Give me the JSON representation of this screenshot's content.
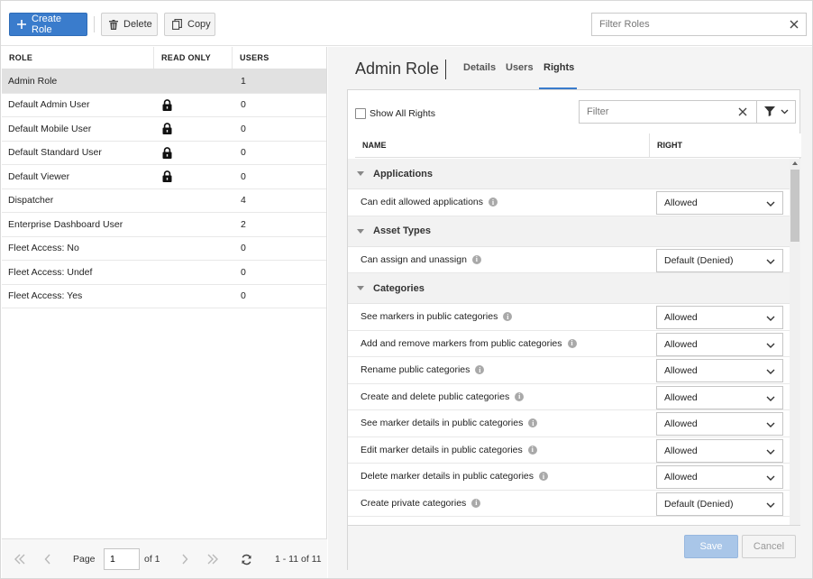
{
  "toolbar": {
    "create_label": "Create Role",
    "delete_label": "Delete",
    "copy_label": "Copy",
    "filter_placeholder": "Filter Roles"
  },
  "roles_table": {
    "headers": [
      "ROLE",
      "READ ONLY",
      "USERS"
    ],
    "rows": [
      {
        "name": "Admin Role",
        "read_only": false,
        "users": "1",
        "selected": true
      },
      {
        "name": "Default Admin User",
        "read_only": true,
        "users": "0"
      },
      {
        "name": "Default Mobile User",
        "read_only": true,
        "users": "0"
      },
      {
        "name": "Default Standard User",
        "read_only": true,
        "users": "0"
      },
      {
        "name": "Default Viewer",
        "read_only": true,
        "users": "0"
      },
      {
        "name": "Dispatcher",
        "read_only": false,
        "users": "4"
      },
      {
        "name": "Enterprise Dashboard User",
        "read_only": false,
        "users": "2"
      },
      {
        "name": "Fleet Access: No",
        "read_only": false,
        "users": "0"
      },
      {
        "name": "Fleet Access: Undef",
        "read_only": false,
        "users": "0"
      },
      {
        "name": "Fleet Access: Yes",
        "read_only": false,
        "users": "0"
      }
    ]
  },
  "pager": {
    "page_label": "Page",
    "page_value": "1",
    "of_label": "of 1",
    "range_label": "1 - 11 of 11"
  },
  "detail": {
    "title": "Admin Role",
    "tabs": [
      "Details",
      "Users",
      "Rights"
    ],
    "active_tab": "Rights",
    "show_all_label": "Show All Rights",
    "filter_placeholder": "Filter",
    "col_name": "NAME",
    "col_right": "RIGHT",
    "groups": [
      {
        "name": "Applications",
        "items": [
          {
            "label": "Can edit allowed applications",
            "value": "Allowed"
          }
        ]
      },
      {
        "name": "Asset Types",
        "items": [
          {
            "label": "Can assign and unassign",
            "value": "Default (Denied)"
          }
        ]
      },
      {
        "name": "Categories",
        "items": [
          {
            "label": "See markers in public categories",
            "value": "Allowed"
          },
          {
            "label": "Add and remove markers from public categories",
            "value": "Allowed"
          },
          {
            "label": "Rename public categories",
            "value": "Allowed"
          },
          {
            "label": "Create and delete public categories",
            "value": "Allowed"
          },
          {
            "label": "See marker details in public categories",
            "value": "Allowed"
          },
          {
            "label": "Edit marker details in public categories",
            "value": "Allowed"
          },
          {
            "label": "Delete marker details in public categories",
            "value": "Allowed"
          },
          {
            "label": "Create private categories",
            "value": "Default (Denied)"
          }
        ]
      }
    ],
    "save_label": "Save",
    "cancel_label": "Cancel"
  },
  "colors": {
    "accent": "#3a7ccc",
    "save_disabled": "#a9c6e8",
    "selected_row": "#e1e1e1"
  }
}
